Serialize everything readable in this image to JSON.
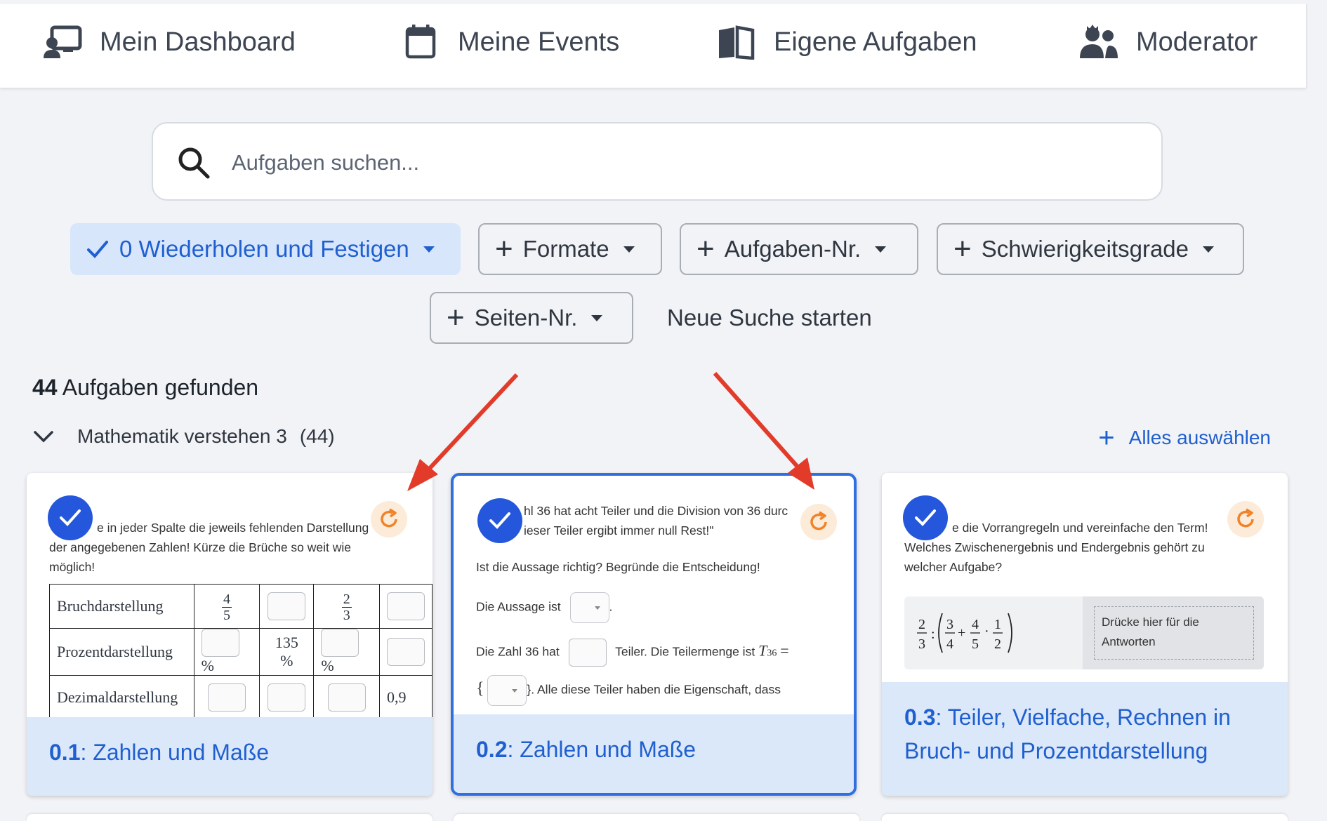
{
  "nav": {
    "items": [
      {
        "label": "Mein Dashboard",
        "icon": "dashboard-icon"
      },
      {
        "label": "Meine Events",
        "icon": "calendar-icon"
      },
      {
        "label": "Eigene Aufgaben",
        "icon": "book-icon"
      },
      {
        "label": "Moderator",
        "icon": "users-icon"
      }
    ]
  },
  "search": {
    "placeholder": "Aufgaben suchen..."
  },
  "filters": {
    "active": "0 Wiederholen und Festigen",
    "formate": "Formate",
    "aufgaben_nr": "Aufgaben-Nr.",
    "schwierigkeit": "Schwierigkeitsgrade",
    "seiten_nr": "Seiten-Nr.",
    "reset": "Neue Suche starten"
  },
  "results": {
    "count": "44",
    "label": "Aufgaben gefunden"
  },
  "group": {
    "name": "Mathematik verstehen 3",
    "count": "(44)",
    "select_all": "Alles auswählen"
  },
  "cards": [
    {
      "number": "0.1",
      "title": ": Zahlen und Maße",
      "text_line1": "e in jeder Spalte die jeweils fehlenden Darstellung",
      "text_line2": "der angegebenen Zahlen! Kürze die Brüche so weit wie",
      "text_line3": "möglich!",
      "rows": [
        "Bruchdarstellung",
        "Prozentdarstellung",
        "Dezimaldarstellung"
      ],
      "frac1_num": "4",
      "frac1_den": "5",
      "frac2_num": "2",
      "frac2_den": "3",
      "pct_sign": "%",
      "pct_value": "135 %",
      "dec_value": "0,9"
    },
    {
      "number": "0.2",
      "title": ": Zahlen und Maße",
      "line1": "hl 36 hat acht Teiler und die Division von 36 durc",
      "line2": "ieser Teiler ergibt immer null Rest!\"",
      "line3": "Ist die Aussage richtig? Begründe die Entscheidung!",
      "line4": "Die Aussage ist",
      "line5a": "Die Zahl 36 hat",
      "line5b": "Teiler. Die Teilermenge ist",
      "teilermenge": "T",
      "teiler_sub": "36",
      "equals": "=",
      "brace_open": "{",
      "line6": "}. Alle diese Teiler haben die Eigenschaft, dass"
    },
    {
      "number": "0.3",
      "title": ": Teiler, Vielfache, Rechnen in",
      "title2": "Bruch- und Prozentdarstellung",
      "line1": "e die Vorrangregeln und vereinfache den Term!",
      "line2": "Welches Zwischenergebnis und Endergebnis gehört zu",
      "line3": "welcher Aufgabe?",
      "answer_hint1": "Drücke hier für die",
      "answer_hint2": "Antworten"
    }
  ],
  "colors": {
    "accent": "#1f5fcf",
    "badge": "#2457dc",
    "refresh": "#f0822a",
    "arrow": "#e23b2a"
  }
}
